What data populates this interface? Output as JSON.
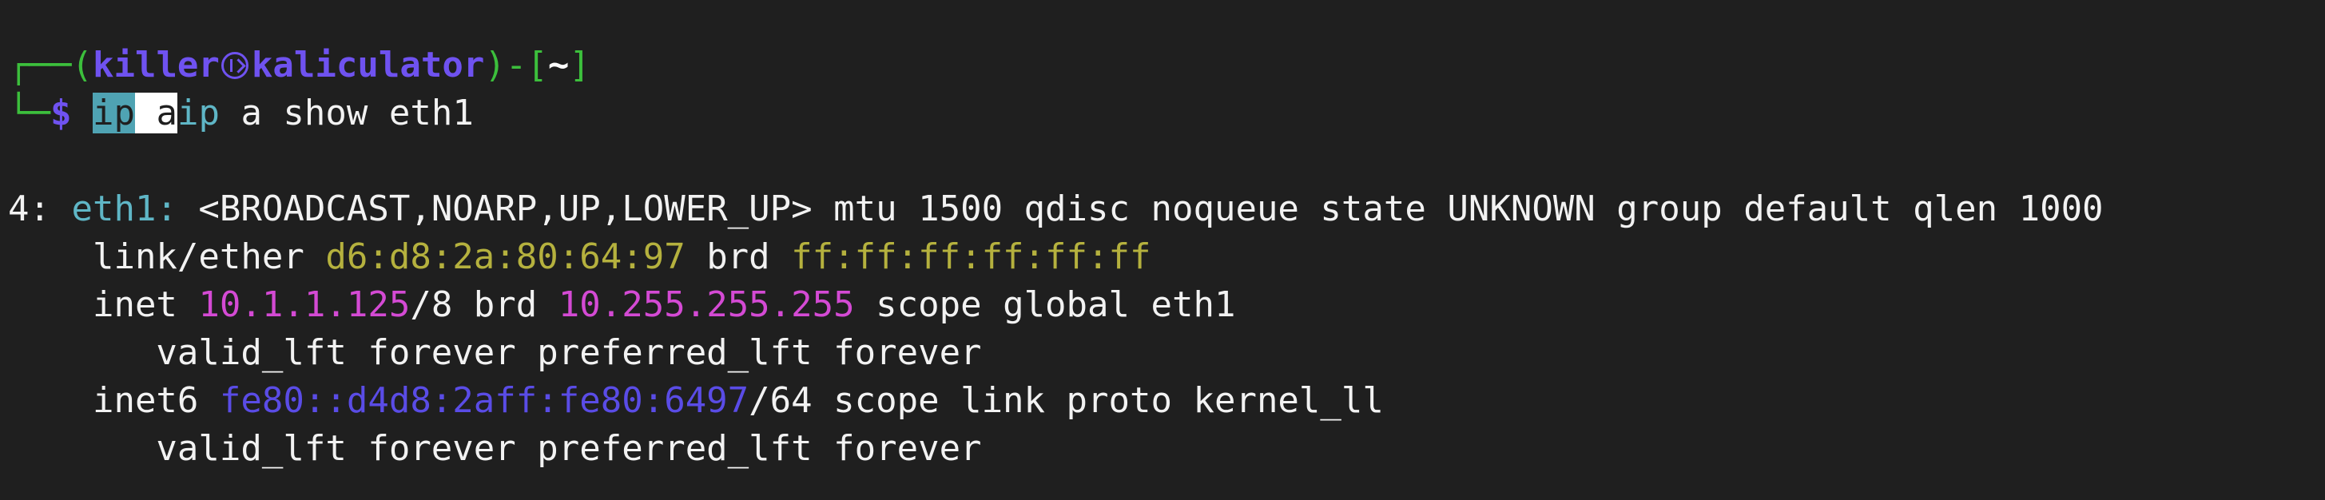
{
  "prompt": {
    "corner_top": "┌──(",
    "user": "killer",
    "host": "kaliculator",
    "bracket_mid": ")-[",
    "cwd": "~",
    "bracket_end": "]",
    "corner_bottom": "└─",
    "dollar": "$",
    "cmd_sel1": "ip",
    "cmd_space": " ",
    "cmd_sel2": "a",
    "cmd_ip": "ip",
    "cmd_rest": " a show eth1"
  },
  "output": {
    "iface_index": "4: ",
    "iface_name": "eth1:",
    "iface_flags": " <BROADCAST,NOARP,UP,LOWER_UP> mtu 1500 qdisc noqueue state UNKNOWN group default qlen 1000",
    "link_label": "    link/ether ",
    "mac": "d6:d8:2a:80:64:97",
    "brd_label": " brd ",
    "mac_brd": "ff:ff:ff:ff:ff:ff",
    "inet_label": "    inet ",
    "ipv4": "10.1.1.125",
    "ipv4_suffix": "/8 brd ",
    "ipv4_brd": "10.255.255.255",
    "ipv4_scope": " scope global eth1",
    "valid1": "       valid_lft forever preferred_lft forever",
    "inet6_label": "    inet6 ",
    "ipv6": "fe80::d4d8:2aff:fe80:6497",
    "ipv6_suffix": "/64 scope link proto kernel_ll",
    "valid2": "       valid_lft forever preferred_lft forever"
  },
  "colors": {
    "background": "#1f1f1f",
    "prompt_frame": "#3cbf3c",
    "prompt_user": "#6f52f0",
    "iface_name": "#5fb6c6",
    "mac": "#b5b13e",
    "ipv4": "#d44ad4",
    "ipv6": "#5a4ce6"
  },
  "icons": {
    "user_host_separator": "kali-dragon-icon"
  }
}
